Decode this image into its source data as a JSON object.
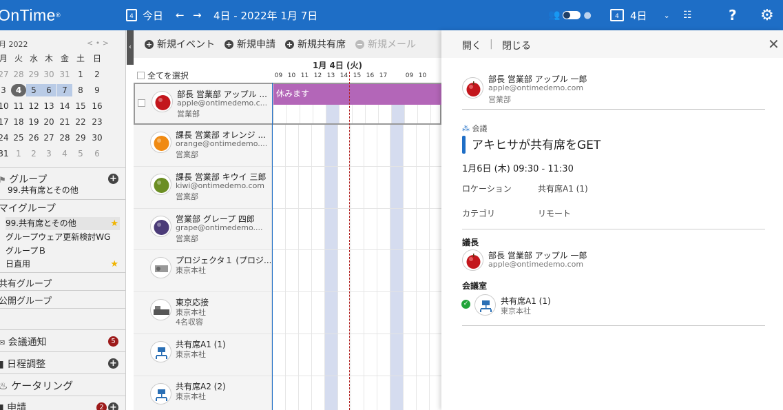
{
  "topbar": {
    "logo": "OnTime",
    "logo_mark": "®",
    "cal_day": "4",
    "today": "今日",
    "date_range": "4日 - 2022年 1月 7日",
    "view_cal_day": "4",
    "view_label": "4日",
    "help": "?"
  },
  "mini_cal": {
    "month": "月 2022",
    "nav": "< • >",
    "weekdays": [
      "月",
      "火",
      "水",
      "木",
      "金",
      "土",
      "日"
    ],
    "weeks": [
      [
        "27",
        "28",
        "29",
        "30",
        "31",
        "1",
        "2"
      ],
      [
        "3",
        "4",
        "5",
        "6",
        "7",
        "8",
        "9"
      ],
      [
        "10",
        "11",
        "12",
        "13",
        "14",
        "15",
        "16"
      ],
      [
        "17",
        "18",
        "19",
        "20",
        "21",
        "22",
        "23"
      ],
      [
        "24",
        "25",
        "26",
        "27",
        "28",
        "29",
        "30"
      ],
      [
        "31",
        "1",
        "2",
        "3",
        "4",
        "5",
        "6"
      ]
    ]
  },
  "left": {
    "group_title": "グループ",
    "group_current": "99.共有席とその他",
    "my_group": "マイグループ",
    "my_groups": [
      "99.共有席とその他",
      "グループウェア更新検討WG",
      "グループＢ",
      "日直用"
    ],
    "shared_group": "共有グループ",
    "public_group": "公開グループ",
    "meeting_notice": "会議通知",
    "meeting_badge": "5",
    "schedule_adjust": "日程調整",
    "catering": "ケータリング",
    "requests": "申請",
    "requests_badge": "2"
  },
  "toolbar": {
    "new_event": "新規イベント",
    "new_request": "新規申請",
    "new_shared_seat": "新規共有席",
    "new_mail": "新規メール"
  },
  "grid": {
    "date_header": "1月 4日 (火)",
    "select_all": "全てを選択",
    "hours": [
      "09",
      "10",
      "11",
      "12",
      "13",
      "14",
      "15",
      "16",
      "17",
      "",
      "09",
      "10"
    ],
    "event_label": "休みます",
    "rows": [
      {
        "name": "部長 営業部 アップル ...",
        "sub1": "apple@ontimedemo.c...",
        "sub2": "営業部"
      },
      {
        "name": "課長 営業部 オレンジ ...",
        "sub1": "orange@ontimedemo....",
        "sub2": "営業部"
      },
      {
        "name": "課長 営業部 キウイ 三郎",
        "sub1": "kiwi@ontimedemo.com",
        "sub2": "営業部"
      },
      {
        "name": "営業部 グレープ 四郎",
        "sub1": "grape@ontimedemo....",
        "sub2": "営業部"
      },
      {
        "name": "プロジェクタ１ (プロジ...",
        "sub1": "東京本社",
        "sub2": ""
      },
      {
        "name": "東京応接",
        "sub1": "東京本社",
        "sub2": "4名収容"
      },
      {
        "name": "共有席A1 (1)",
        "sub1": "東京本社",
        "sub2": ""
      },
      {
        "name": "共有席A2 (2)",
        "sub1": "東京本社",
        "sub2": ""
      }
    ]
  },
  "panel": {
    "open": "開く",
    "sep": "|",
    "close": "閉じる",
    "owner_name": "部長 営業部 アップル 一郎",
    "owner_email": "apple@ontimedemo.com",
    "owner_dept": "営業部",
    "type": "会議",
    "title": "アキヒサが共有席をGET",
    "datetime": "1月6日 (木) 09:30  -  11:30",
    "location_label": "ロケーション",
    "location_value": "共有席A1 (1)",
    "category_label": "カテゴリ",
    "category_value": "リモート",
    "chair_label": "議長",
    "chair_name": "部長 営業部 アップル 一郎",
    "chair_email": "apple@ontimedemo.com",
    "room_label": "会議室",
    "room_name": "共有席A1 (1)",
    "room_loc": "東京本社"
  },
  "colors": {
    "brand": "#1e6ec6",
    "event": "#b366b8",
    "slot_busy": "#d5dcef",
    "now_line": "#b22222"
  }
}
